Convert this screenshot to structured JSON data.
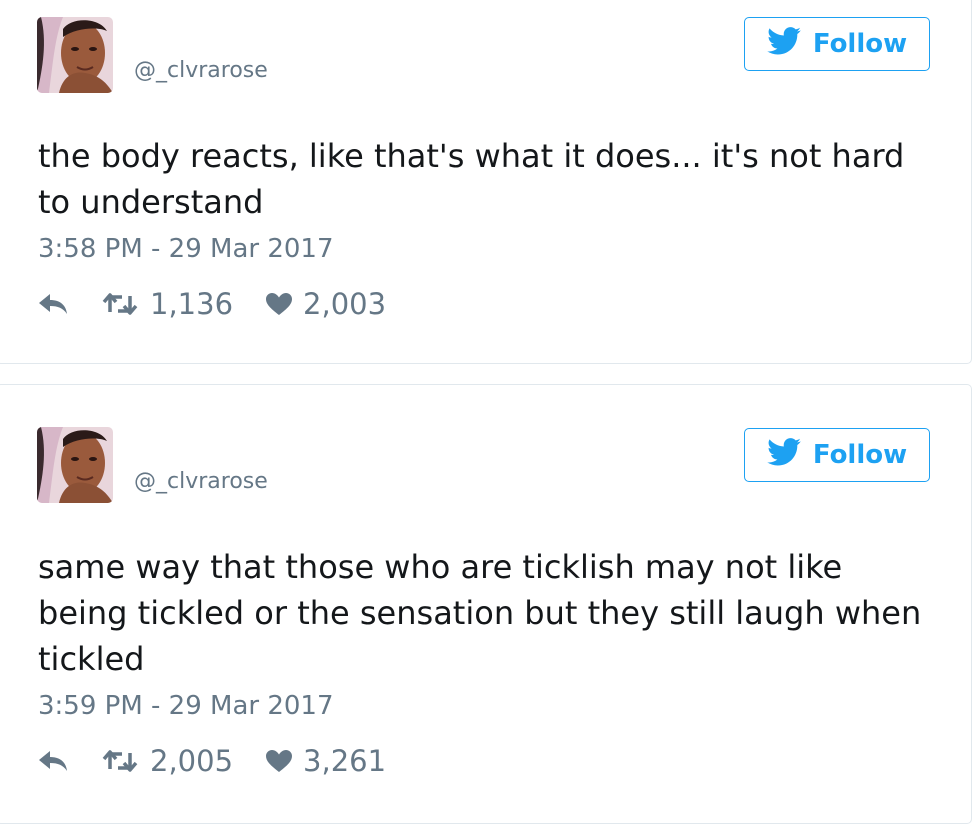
{
  "tweets": [
    {
      "handle": "@_clvrarose",
      "follow_label": "Follow",
      "text": "the body reacts, like that's what it does... it's not hard to understand",
      "timestamp": "3:58 PM - 29 Mar 2017",
      "retweets": "1,136",
      "likes": "2,003"
    },
    {
      "handle": "@_clvrarose",
      "follow_label": "Follow",
      "text": "same way that those who are ticklish may not like being tickled or the sensation but they still laugh when tickled",
      "timestamp": "3:59 PM - 29 Mar 2017",
      "retweets": "2,005",
      "likes": "3,261"
    }
  ],
  "icons": {
    "follow": "twitter-bird-icon",
    "reply": "reply-icon",
    "retweet": "retweet-icon",
    "like": "heart-icon"
  },
  "colors": {
    "accent": "#1da1f2",
    "muted": "#657786",
    "text": "#14171a",
    "border": "#e1e8ed"
  }
}
